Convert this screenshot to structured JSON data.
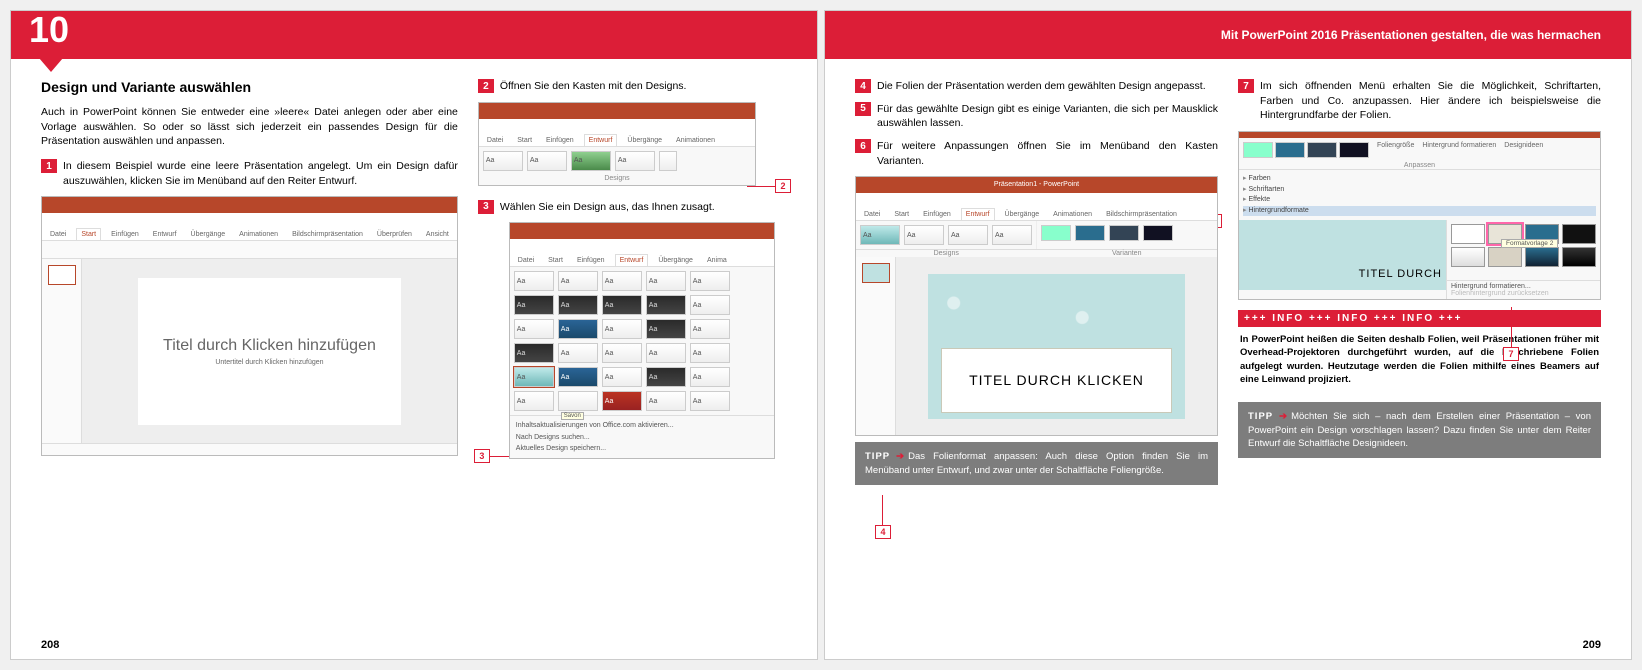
{
  "chapter": {
    "number": "10",
    "title": "Mit PowerPoint 2016 Präsentationen gestalten, die was hermachen"
  },
  "pages": {
    "left": "208",
    "right": "209"
  },
  "heading": "Design und Variante auswählen",
  "intro": "Auch in PowerPoint können Sie entweder eine »leere« Datei anlegen oder aber eine Vorlage auswählen. So oder so lässt sich jederzeit ein passendes Design für die Präsentation auswählen und anpassen.",
  "steps": {
    "1": "In diesem Beispiel wurde eine leere Präsentation angelegt. Um ein Design dafür auszuwählen, klicken Sie im Menüband auf den Reiter Entwurf.",
    "2": "Öffnen Sie den Kasten mit den Designs.",
    "3": "Wählen Sie ein Design aus, das Ihnen zusagt.",
    "4": "Die Folien der Präsentation werden dem gewählten Design angepasst.",
    "5": "Für das gewählte Design gibt es einige Varianten, die sich per Mausklick auswählen lassen.",
    "6": "Für weitere Anpassungen öffnen Sie im Menüband den Kasten Varianten.",
    "7": "Im sich öffnenden Menü erhalten Sie die Möglichkeit, Schriftarten, Farben und Co. anzupassen. Hier ändere ich beispielsweise die Hintergrundfarbe der Folien."
  },
  "shot1": {
    "tabs": [
      "Datei",
      "Start",
      "Einfügen",
      "Entwurf",
      "Übergänge",
      "Animationen",
      "Bildschirmpräsentation",
      "Überprüfen",
      "Ansicht"
    ],
    "title_placeholder": "Titel durch Klicken hinzufügen",
    "subtitle_placeholder": "Untertitel durch Klicken hinzufügen"
  },
  "shot2": {
    "tabs": [
      "Datei",
      "Start",
      "Einfügen",
      "Entwurf",
      "Übergänge",
      "Animationen"
    ],
    "group_label": "Designs"
  },
  "shot3": {
    "tabs": [
      "Datei",
      "Start",
      "Einfügen",
      "Entwurf",
      "Übergänge",
      "Anima"
    ],
    "footer_items": [
      "Inhaltsaktualisierungen von Office.com aktivieren...",
      "Nach Designs suchen...",
      "Aktuelles Design speichern..."
    ],
    "tooltip": "Savon"
  },
  "shot4": {
    "title_text": "TITEL DURCH KLICKEN",
    "group_designs": "Designs",
    "group_variants": "Varianten",
    "app_caption": "Präsentation1 - PowerPoint"
  },
  "shot5": {
    "anpassen_items": [
      "Farben",
      "Schriftarten",
      "Effekte",
      "Hintergrundformate"
    ],
    "side_items": [
      "Foliengröße",
      "Hintergrund formatieren",
      "Designideen"
    ],
    "group": "Anpassen",
    "format_tooltip": "Formatvorlage 2",
    "menu_items": [
      "Hintergrund formatieren...",
      "Folienhintergrund zurücksetzen"
    ],
    "preview_text": "TITEL DURCH"
  },
  "info": {
    "bar": "+++  INFO  +++  INFO  +++  INFO  +++",
    "text": "In PowerPoint heißen die Seiten deshalb Folien, weil Präsentationen früher mit Overhead-Projektoren durchgeführt wurden, auf die beschriebene Folien aufgelegt wurden. Heutzutage werden die Folien mithilfe eines Beamers auf eine Leinwand projiziert."
  },
  "tipp": {
    "label": "TIPP",
    "left": "Das Folienformat anpassen: Auch diese Option finden Sie im Menüband unter Entwurf, und zwar unter der Schaltfläche Foliengröße.",
    "right": "Möchten Sie sich – nach dem Erstellen einer Präsentation – von PowerPoint ein Design vorschlagen lassen? Dazu finden Sie unter dem Reiter Entwurf die Schaltfläche Designideen."
  }
}
